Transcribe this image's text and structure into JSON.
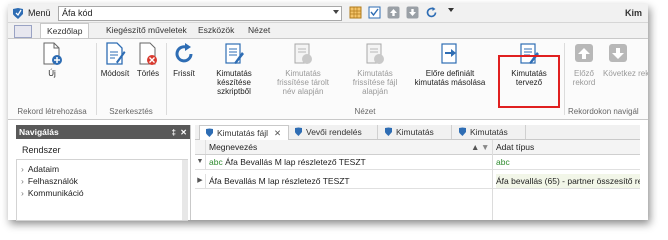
{
  "titlebar": {
    "menu_label": "Menü",
    "menu_value": "Áfa kód",
    "right_title": "Kim"
  },
  "tabs": [
    "Kezdőlap",
    "Kiegészítő műveletek",
    "Eszközök",
    "Nézet"
  ],
  "ribbon": {
    "buttons": {
      "new": "Új",
      "edit": "Módosít",
      "delete": "Törlés",
      "refresh": "Frissít",
      "create_report": "Kimutatás készítése szkriptből",
      "refresh_saved": "Kimutatás frissítése tárolt név alapján",
      "refresh_file": "Kimutatás frissítése fájl alapján",
      "predefined_copy": "Előre definiált kimutatás másolása",
      "report_designer": "Kimutatás tervező",
      "prev_record": "Előző rekord",
      "next_record": "Következ rekord"
    },
    "groups": {
      "create": "Rekord létrehozása",
      "edit": "Szerkesztés",
      "view": "Nézet",
      "navigate": "Rekordokon navigál"
    }
  },
  "nav": {
    "title": "Navigálás",
    "pin": "ᵖ",
    "section": "Rendszer",
    "items": [
      "Adataim",
      "Felhasználók",
      "Kommunikáció"
    ]
  },
  "doc_tabs": [
    "Kimutatás fájl",
    "Vevői rendelés",
    "Kimutatás",
    "Kimutatás"
  ],
  "grid": {
    "columns": [
      "Megnevezés",
      "Adat típus"
    ],
    "filter_row": [
      "Áfa Bevallás M lap részletező TESZT",
      ""
    ],
    "rows": [
      [
        "Áfa Bevallás M lap részletező TESZT",
        "Áfa bevallás (65) - partner összesítő re"
      ]
    ]
  },
  "colors": {
    "accent": "#2e6db4",
    "highlight": "#e02020",
    "nav_header": "#595959"
  }
}
